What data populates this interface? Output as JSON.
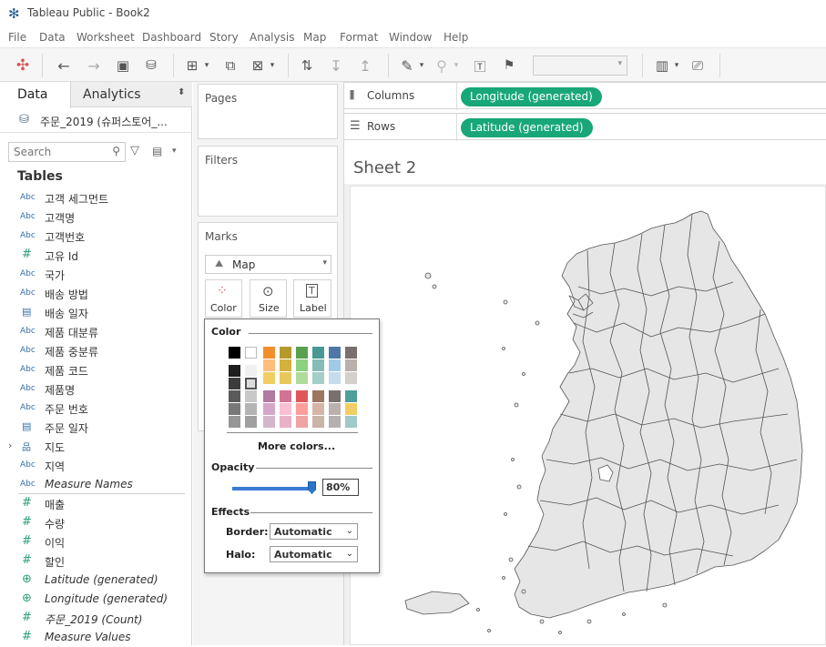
{
  "app": {
    "title": "Tableau Public - Book2"
  },
  "menu": [
    "File",
    "Data",
    "Worksheet",
    "Dashboard",
    "Story",
    "Analysis",
    "Map",
    "Format",
    "Window",
    "Help"
  ],
  "data_pane": {
    "tabs": {
      "data": "Data",
      "analytics": "Analytics"
    },
    "datasource": "주문_2019 (슈퍼스토어_...",
    "search_placeholder": "Search",
    "tables_heading": "Tables",
    "fields": [
      {
        "type": "Abc",
        "name": "고객 세그먼트"
      },
      {
        "type": "Abc",
        "name": "고객명"
      },
      {
        "type": "Abc",
        "name": "고객번호"
      },
      {
        "type": "#",
        "name": "고유 Id"
      },
      {
        "type": "Abc",
        "name": "국가"
      },
      {
        "type": "Abc",
        "name": "배송 방법"
      },
      {
        "type": "date",
        "name": "배송 일자"
      },
      {
        "type": "Abc",
        "name": "제품 대분류"
      },
      {
        "type": "Abc",
        "name": "제품 중분류"
      },
      {
        "type": "Abc",
        "name": "제품 코드"
      },
      {
        "type": "Abc",
        "name": "제품명"
      },
      {
        "type": "Abc",
        "name": "주문 번호"
      },
      {
        "type": "date",
        "name": "주문 일자"
      },
      {
        "type": "hier",
        "name": "지도"
      },
      {
        "type": "Abc",
        "name": "지역"
      },
      {
        "type": "Abc",
        "name": "Measure Names",
        "italic": true
      },
      {
        "type": "#",
        "name": "매출"
      },
      {
        "type": "#",
        "name": "수량"
      },
      {
        "type": "#",
        "name": "이익"
      },
      {
        "type": "#",
        "name": "할인"
      },
      {
        "type": "globe",
        "name": "Latitude (generated)",
        "italic": true
      },
      {
        "type": "globe",
        "name": "Longitude (generated)",
        "italic": true
      },
      {
        "type": "#",
        "name": "주문_2019 (Count)",
        "italic": true
      },
      {
        "type": "#",
        "name": "Measure Values",
        "italic": true
      }
    ]
  },
  "cards": {
    "pages": "Pages",
    "filters": "Filters",
    "marks": "Marks",
    "mark_type": "Map",
    "mark_buttons": {
      "color": "Color",
      "size": "Size",
      "label": "Label"
    }
  },
  "shelves": {
    "columns_label": "Columns",
    "columns_pill": "Longitude (generated)",
    "rows_label": "Rows",
    "rows_pill": "Latitude (generated)"
  },
  "sheet": {
    "title": "Sheet 2"
  },
  "color_popup": {
    "color_heading": "Color",
    "more_colors": "More colors...",
    "opacity_heading": "Opacity",
    "opacity_value": "80%",
    "opacity_fraction": 0.8,
    "effects_heading": "Effects",
    "border_label": "Border:",
    "border_value": "Automatic",
    "halo_label": "Halo:",
    "halo_value": "Automatic",
    "palette_colors": {
      "gray_col": [
        "#000000",
        "#1e1e1e",
        "#3c3c3c",
        "#5a5a5a",
        "#787878",
        "#969696"
      ],
      "white_col": [
        "#ffffff",
        "#f0f0f0",
        "#dcdcdc",
        "#c8c8c8",
        "#b4b4b4",
        "#a0a0a0"
      ],
      "row1": [
        "#f28e2b",
        "#b6992d",
        "#59a14f",
        "#499894",
        "#4e79a7",
        "#79706e"
      ],
      "row2": [
        "#ffbe7d",
        "#d4b03c",
        "#8cd17d",
        "#86bcb6",
        "#a0cbe8",
        "#bab0ac"
      ],
      "row3": [
        "#f1ce63",
        "#e8c85a",
        "#b1db99",
        "#a3cfc8",
        "#c5dcef",
        "#d4cfcb"
      ],
      "row4": [
        "#b07aa1",
        "#d37295",
        "#e15759",
        "#9d7660",
        "#79706e",
        "#4e9e9a"
      ],
      "row5": [
        "#d4a6c8",
        "#fabfd2",
        "#ff9d9a",
        "#d7b5a6",
        "#bab0ac",
        "#f1ce63"
      ]
    }
  },
  "map": {
    "fill": "#e6e6e6",
    "stroke": "#555555"
  }
}
